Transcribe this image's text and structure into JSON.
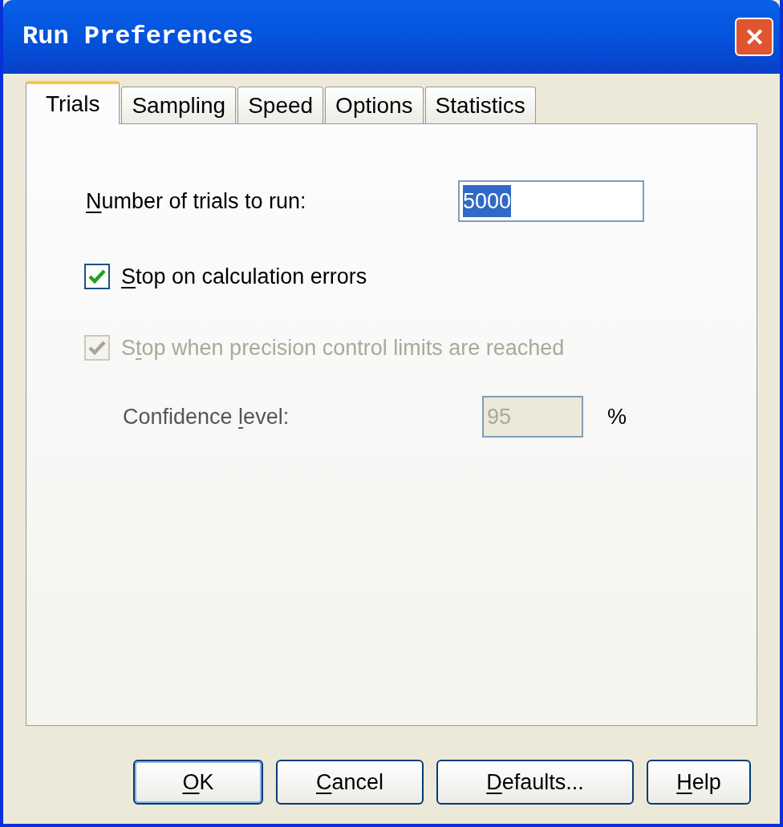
{
  "window": {
    "title": "Run Preferences",
    "close": "✕"
  },
  "tabs": [
    {
      "label": "Trials",
      "selected": true
    },
    {
      "label": "Sampling",
      "selected": false
    },
    {
      "label": "Speed",
      "selected": false
    },
    {
      "label": "Options",
      "selected": false
    },
    {
      "label": "Statistics",
      "selected": false
    }
  ],
  "trials_field": {
    "label": [
      {
        "text": "N",
        "underlined": true
      },
      {
        "text": "umber of trials to run:",
        "underlined": false
      }
    ],
    "value": "5000"
  },
  "checkboxes": [
    {
      "label": [
        {
          "text": "S",
          "underlined": true
        },
        {
          "text": "top on calculation errors",
          "underlined": false
        }
      ],
      "checked": true,
      "disabled": false
    },
    {
      "label": [
        {
          "text": "S",
          "underlined": false
        },
        {
          "text": "t",
          "underlined": true
        },
        {
          "text": "op when precision control limits are reached",
          "underlined": false
        }
      ],
      "checked": true,
      "disabled": true
    }
  ],
  "confidence_field": {
    "label": [
      {
        "text": "Confidence ",
        "underlined": false
      },
      {
        "text": "l",
        "underlined": true
      },
      {
        "text": "evel:",
        "underlined": false
      }
    ],
    "value": "95",
    "unit": "%",
    "disabled": true
  },
  "buttons": [
    {
      "label": [
        {
          "text": "O",
          "underlined": true
        },
        {
          "text": "K",
          "underlined": false
        }
      ],
      "default": true
    },
    {
      "label": [
        {
          "text": "C",
          "underlined": true
        },
        {
          "text": "ancel",
          "underlined": false
        }
      ],
      "default": false
    },
    {
      "label": [
        {
          "text": "D",
          "underlined": true
        },
        {
          "text": "efaults...",
          "underlined": false
        }
      ],
      "default": false
    },
    {
      "label": [
        {
          "text": "H",
          "underlined": true
        },
        {
          "text": "elp",
          "underlined": false
        }
      ],
      "default": false
    }
  ]
}
